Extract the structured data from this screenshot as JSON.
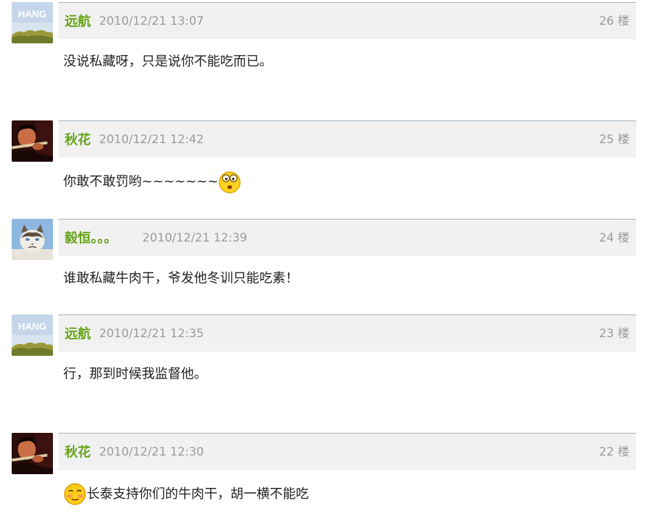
{
  "posts": [
    {
      "author": "远航",
      "time": "2010/12/21 13:07",
      "floor": "26 楼",
      "content": "没说私藏呀，只是说你不能吃而已。",
      "avatar": "hang-sky-avatar"
    },
    {
      "author": "秋花",
      "time": "2010/12/21 12:42",
      "floor": "25 楼",
      "content": "你敢不敢罚哟~~~~~~~",
      "avatar": "person-flute-avatar",
      "emoji_after": "surprised-face-icon"
    },
    {
      "author": "毅恒。。。",
      "time": "2010/12/21 12:39",
      "floor": "24 楼",
      "content": "谁敢私藏牛肉干，爷发他冬训只能吃素！",
      "avatar": "grumpy-cat-avatar"
    },
    {
      "author": "远航",
      "time": "2010/12/21 12:35",
      "floor": "23 楼",
      "content": "行，那到时候我监督他。",
      "avatar": "hang-sky-avatar"
    },
    {
      "author": "秋花",
      "time": "2010/12/21 12:30",
      "floor": "22 楼",
      "content": "长泰支持你们的牛肉干，胡一横不能吃",
      "avatar": "person-flute-avatar",
      "emoji_before": "sly-face-icon"
    }
  ],
  "avatar_texts": {
    "hang": "HANG"
  },
  "colors": {
    "author": "#66a318",
    "meta": "#9b9b9b",
    "header_bg": "#f1f1f1",
    "header_border": "#9fb4c4"
  }
}
